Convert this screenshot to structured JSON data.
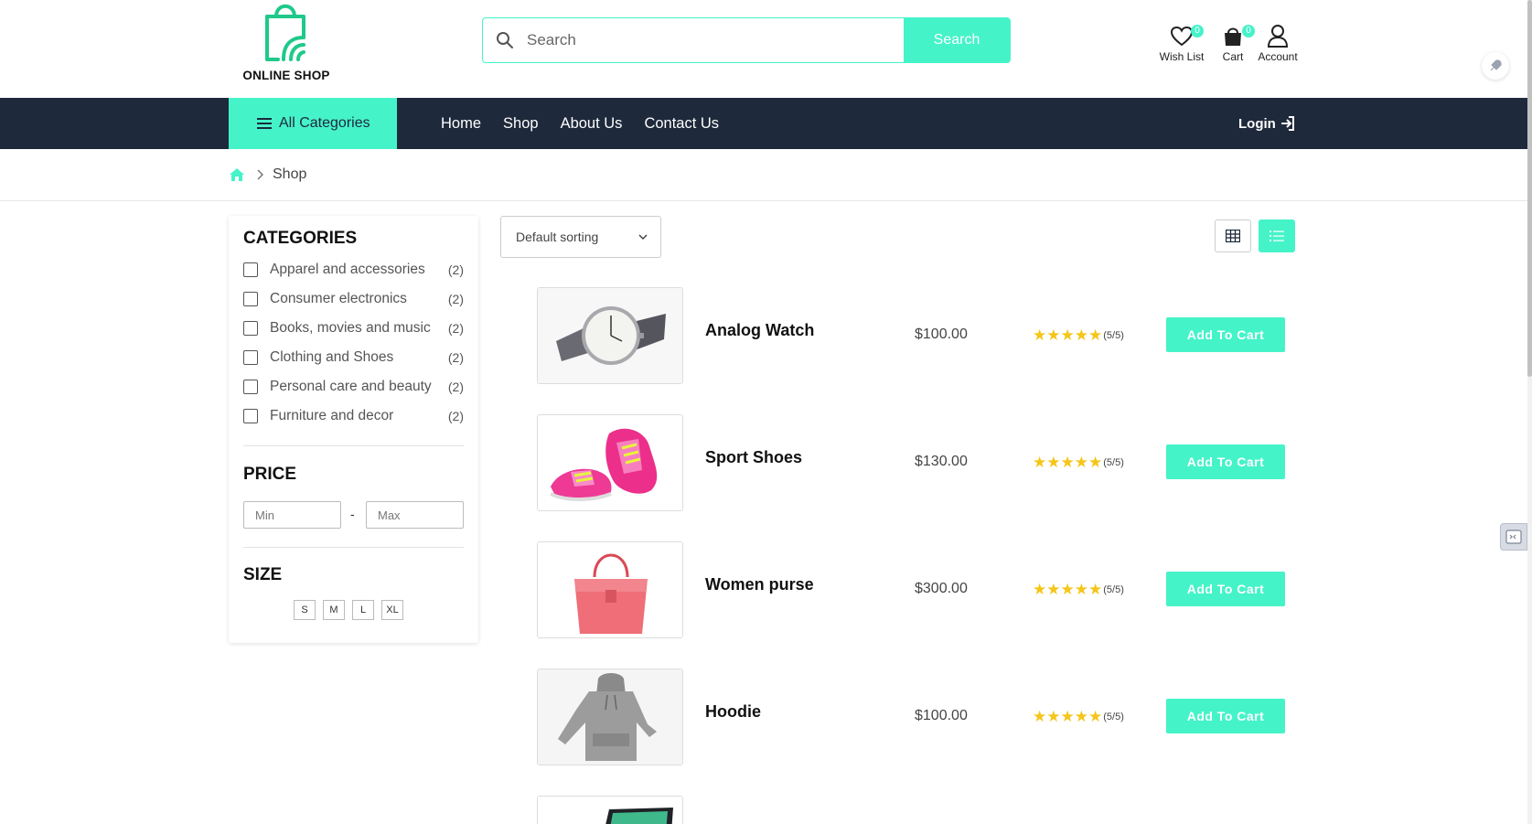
{
  "header": {
    "logo_text": "ONLINE SHOP",
    "search": {
      "placeholder": "Search",
      "button_label": "Search"
    },
    "wishlist": {
      "label": "Wish List",
      "count": "0"
    },
    "cart": {
      "label": "Cart",
      "count": "0"
    },
    "account": {
      "label": "Account"
    }
  },
  "nav": {
    "all_categories": "All Categories",
    "links": [
      "Home",
      "Shop",
      "About Us",
      "Contact Us"
    ],
    "login": "Login"
  },
  "breadcrumb": {
    "current": "Shop"
  },
  "sidebar": {
    "categories_title": "CATEGORIES",
    "categories": [
      {
        "name": "Apparel and accessories",
        "count": "(2)"
      },
      {
        "name": "Consumer electronics",
        "count": "(2)"
      },
      {
        "name": "Books, movies and music",
        "count": "(2)"
      },
      {
        "name": "Clothing and Shoes",
        "count": "(2)"
      },
      {
        "name": "Personal care and beauty",
        "count": "(2)"
      },
      {
        "name": "Furniture and decor",
        "count": "(2)"
      }
    ],
    "price_title": "PRICE",
    "price_min_placeholder": "Min",
    "price_max_placeholder": "Max",
    "price_separator": "-",
    "size_title": "SIZE",
    "sizes": [
      "S",
      "M",
      "L",
      "XL"
    ]
  },
  "toolbar": {
    "sort_label": "Default sorting"
  },
  "products": [
    {
      "name": "Analog Watch",
      "price": "$100.00",
      "rating": "(5/5)",
      "button": "Add To Cart"
    },
    {
      "name": "Sport Shoes",
      "price": "$130.00",
      "rating": "(5/5)",
      "button": "Add To Cart"
    },
    {
      "name": "Women purse",
      "price": "$300.00",
      "rating": "(5/5)",
      "button": "Add To Cart"
    },
    {
      "name": "Hoodie",
      "price": "$100.00",
      "rating": "(5/5)",
      "button": "Add To Cart"
    }
  ],
  "colors": {
    "accent": "#45f3c9",
    "nav_bg": "#1e293b",
    "star": "#f5c518"
  },
  "icons": [
    "search-icon",
    "heart-icon",
    "shopping-bag-icon",
    "user-icon",
    "menu-icon",
    "login-icon",
    "home-icon",
    "chevron-right-icon",
    "chevron-down-icon",
    "grid-view-icon",
    "list-view-icon",
    "star-icon",
    "rocket-icon",
    "chat-icon"
  ]
}
